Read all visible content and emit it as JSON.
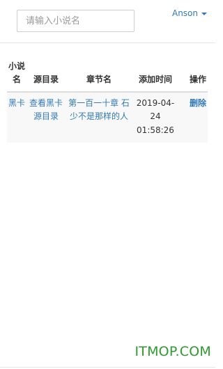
{
  "search": {
    "placeholder": "请输入小说名"
  },
  "user": {
    "name": "Anson"
  },
  "table": {
    "headers": [
      "小说名",
      "源目录",
      "章节名",
      "添加时间",
      "操作"
    ],
    "rows": [
      {
        "novel": "黑卡",
        "source": "查看黑卡源目录",
        "chapter": "第一百一十章 石少不是那样的人",
        "time": "2019-04-24 01:58:26",
        "action": "删除"
      }
    ]
  },
  "watermark": "ITMOP.COM"
}
